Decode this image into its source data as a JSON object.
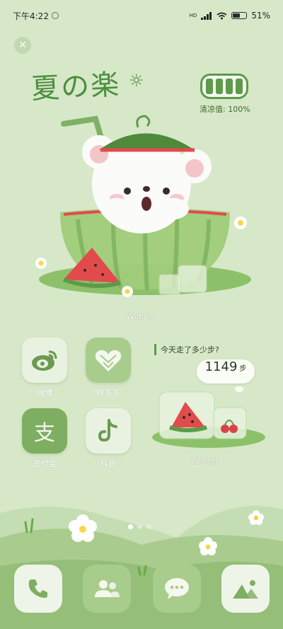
{
  "status_bar": {
    "time": "下午4:22",
    "network": "HD",
    "battery": "51%"
  },
  "title": {
    "text": "夏の楽"
  },
  "coolness": {
    "label": "清凉值: 100%",
    "bars": 4
  },
  "widgets": {
    "hero_label": "Widget",
    "steps_label": "Widget",
    "steps_title": "今天走了多少步?",
    "steps_count": "1149",
    "steps_unit": "步"
  },
  "apps": [
    {
      "label": "微博",
      "icon": "weibo-icon"
    },
    {
      "label": "拼多多",
      "icon": "pinduoduo-icon"
    },
    {
      "label": "支付宝",
      "icon": "alipay-icon"
    },
    {
      "label": "抖音",
      "icon": "douyin-icon"
    }
  ],
  "alipay_glyph": "支",
  "dock": [
    {
      "icon": "phone-icon"
    },
    {
      "icon": "contacts-icon"
    },
    {
      "icon": "messages-icon"
    },
    {
      "icon": "gallery-icon"
    }
  ],
  "page_indicator": {
    "count": 3,
    "active": 1
  },
  "colors": {
    "background": "#d7e8c9",
    "accent_green": "#5e9a4a",
    "dark_green": "#4d8f3e",
    "watermelon_red": "#e24b4b"
  }
}
